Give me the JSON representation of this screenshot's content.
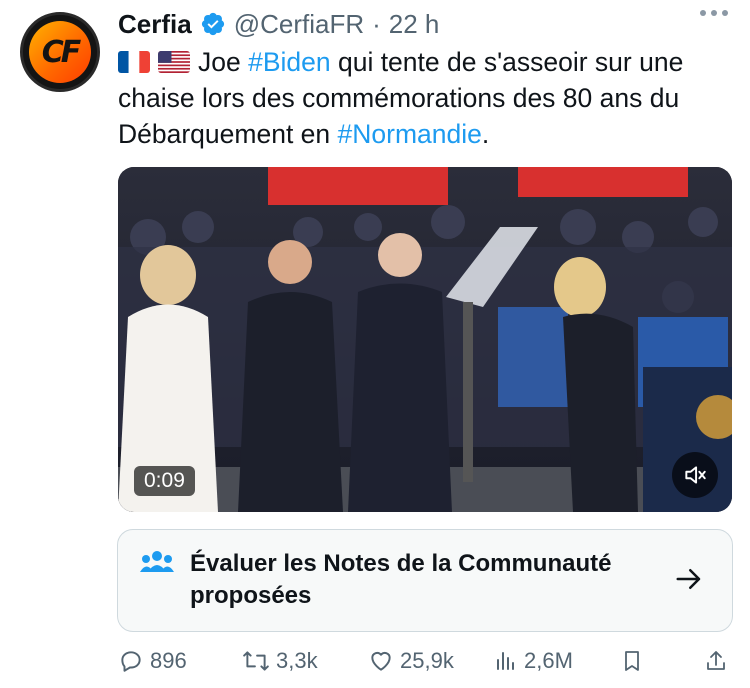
{
  "tweet": {
    "author_name": "Cerfia",
    "author_handle": "@CerfiaFR",
    "separator": "·",
    "time": "22 h",
    "avatar_text": "CF",
    "text_before_1": "Joe ",
    "hashtag_1": "#Biden",
    "text_middle": " qui tente de s'asseoir sur une chaise lors des commémorations des 80 ans du Débarquement en ",
    "hashtag_2": "#Normandie",
    "text_end": ".",
    "flags": [
      "france-flag",
      "usa-flag"
    ]
  },
  "media": {
    "duration": "0:09",
    "mute_icon": "speaker-muted-icon"
  },
  "community_notes": {
    "label": "Évaluer les Notes de la Communauté proposées",
    "icon": "people-icon",
    "arrow_icon": "arrow-right-icon"
  },
  "actions": {
    "replies": "896",
    "reposts": "3,3k",
    "likes": "25,9k",
    "views": "2,6M"
  },
  "colors": {
    "accent": "#1d9bf0",
    "text": "#0f1419",
    "secondary": "#536471",
    "border": "#cfd9de"
  }
}
